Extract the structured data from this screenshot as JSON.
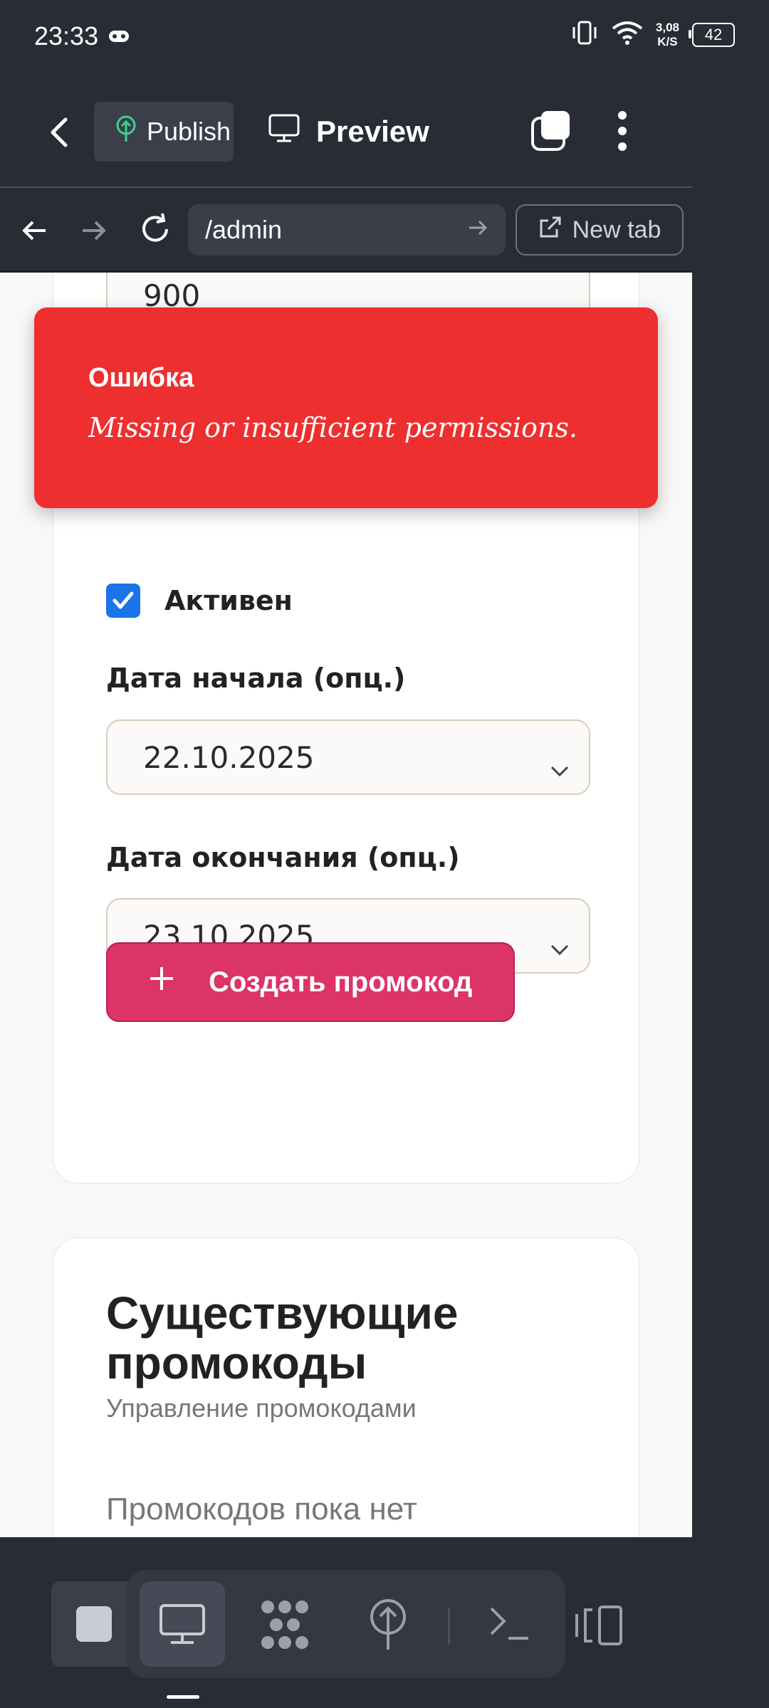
{
  "status_bar": {
    "time": "23:33",
    "net_speed_value": "3,08",
    "net_speed_unit": "K/S",
    "battery": "42"
  },
  "toolbar": {
    "publish_label": "Publish",
    "preview_label": "Preview"
  },
  "browser": {
    "url": "/admin",
    "new_tab_label": "New tab"
  },
  "form": {
    "top_field_value": "900",
    "active_label": "Активен",
    "active_checked": true,
    "start_date_label": "Дата начала (опц.)",
    "start_date_value": "22.10.2025",
    "end_date_label": "Дата окончания (опц.)",
    "end_date_value": "23.10.2025",
    "create_button_label": "Создать промокод"
  },
  "existing": {
    "title": "Существующие промокоды",
    "subtitle": "Управление промокодами",
    "empty_text": "Промокодов пока нет"
  },
  "toast": {
    "title": "Ошибка",
    "message": "Missing or insufficient permissions."
  },
  "colors": {
    "toast_bg": "#ee2f2f",
    "create_button": "#dc3468",
    "checkbox": "#1a73e8",
    "chrome_bg": "#282c35"
  }
}
